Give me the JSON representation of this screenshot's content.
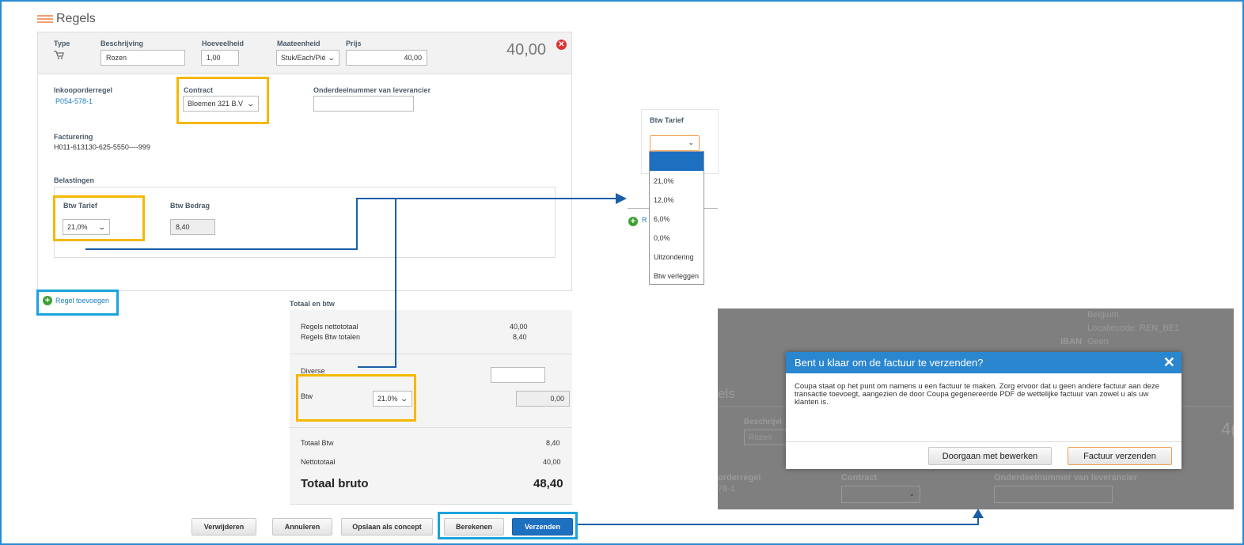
{
  "section": {
    "title": "Regels"
  },
  "line": {
    "headers": {
      "type": "Type",
      "description": "Beschrijving",
      "quantity": "Hoeveelheid",
      "unit": "Maateenheid",
      "price": "Prijs"
    },
    "description_value": "Rozen",
    "quantity_value": "1,00",
    "unit_value": "Stuk/Each/Pié",
    "price_value": "40,00",
    "line_total": "40,00"
  },
  "details": {
    "po_line_label": "Inkooporderregel",
    "po_line_value": "P054-578-1",
    "contract_label": "Contract",
    "contract_value": "Bloemen 321 B.V",
    "part_number_label": "Onderdeelnummer van leverancier",
    "billing_label": "Facturering",
    "billing_value": "H011-613130-625-5550----999"
  },
  "taxes": {
    "section_label": "Belastingen",
    "rate_label": "Btw Tarief",
    "rate_value": "21,0%",
    "amount_label": "Btw Bedrag",
    "amount_value": "8,40"
  },
  "add_line_label": "Regel toevoegen",
  "totals": {
    "title": "Totaal en btw",
    "net_lines_label": "Regels nettototaal",
    "net_lines_value": "40,00",
    "tax_lines_label": "Regels Btw totalen",
    "tax_lines_value": "8,40",
    "misc_label": "Diverse",
    "btw_label": "Btw",
    "btw_rate": "21.0%",
    "btw_value": "0,00",
    "total_tax_label": "Totaal Btw",
    "total_tax_value": "8,40",
    "net_total_label": "Nettototaal",
    "net_total_value": "40,00",
    "gross_label": "Totaal bruto",
    "gross_value": "48,40"
  },
  "buttons": {
    "delete": "Verwijderen",
    "cancel": "Annuleren",
    "save_draft": "Opslaan als concept",
    "calculate": "Berekenen",
    "submit": "Verzenden"
  },
  "dropdown": {
    "label": "Btw Tarief",
    "options": [
      "21,0%",
      "12,0%",
      "6,0%",
      "0,0%",
      "Uitzondering",
      "Btw verleggen"
    ],
    "add_partial": "R"
  },
  "dialog_bg": {
    "country": "Belgium",
    "location_label": "Locatiecode:",
    "location_value": "REN_BE1",
    "iban_label": "IBAN",
    "iban_value": "Geen",
    "section_partial": "els",
    "description_label_partial": "Beschrijvi",
    "description_value_partial": "Rozen",
    "total_partial": "4(",
    "po_label_partial": "orderregel",
    "po_value_partial": "78-1",
    "contract_label": "Contract",
    "part_number_label": "Onderdeelnummer van leverancier"
  },
  "dialog": {
    "title": "Bent u klaar om de factuur te verzenden?",
    "message": "Coupa staat op het punt om namens u een factuur te maken. Zorg ervoor dat u geen andere factuur aan deze transactie toevoegt, aangezien de door Coupa gegenereerde PDF de wettelijke factuur van zowel u als uw klanten is.",
    "continue_label": "Doorgaan met bewerken",
    "send_label": "Factuur verzenden"
  },
  "colors": {
    "highlight_yellow": "#f6b800",
    "highlight_blue": "#1aa3dd",
    "dialog_header": "#2a86cf",
    "primary_button": "#1d6fc0"
  }
}
